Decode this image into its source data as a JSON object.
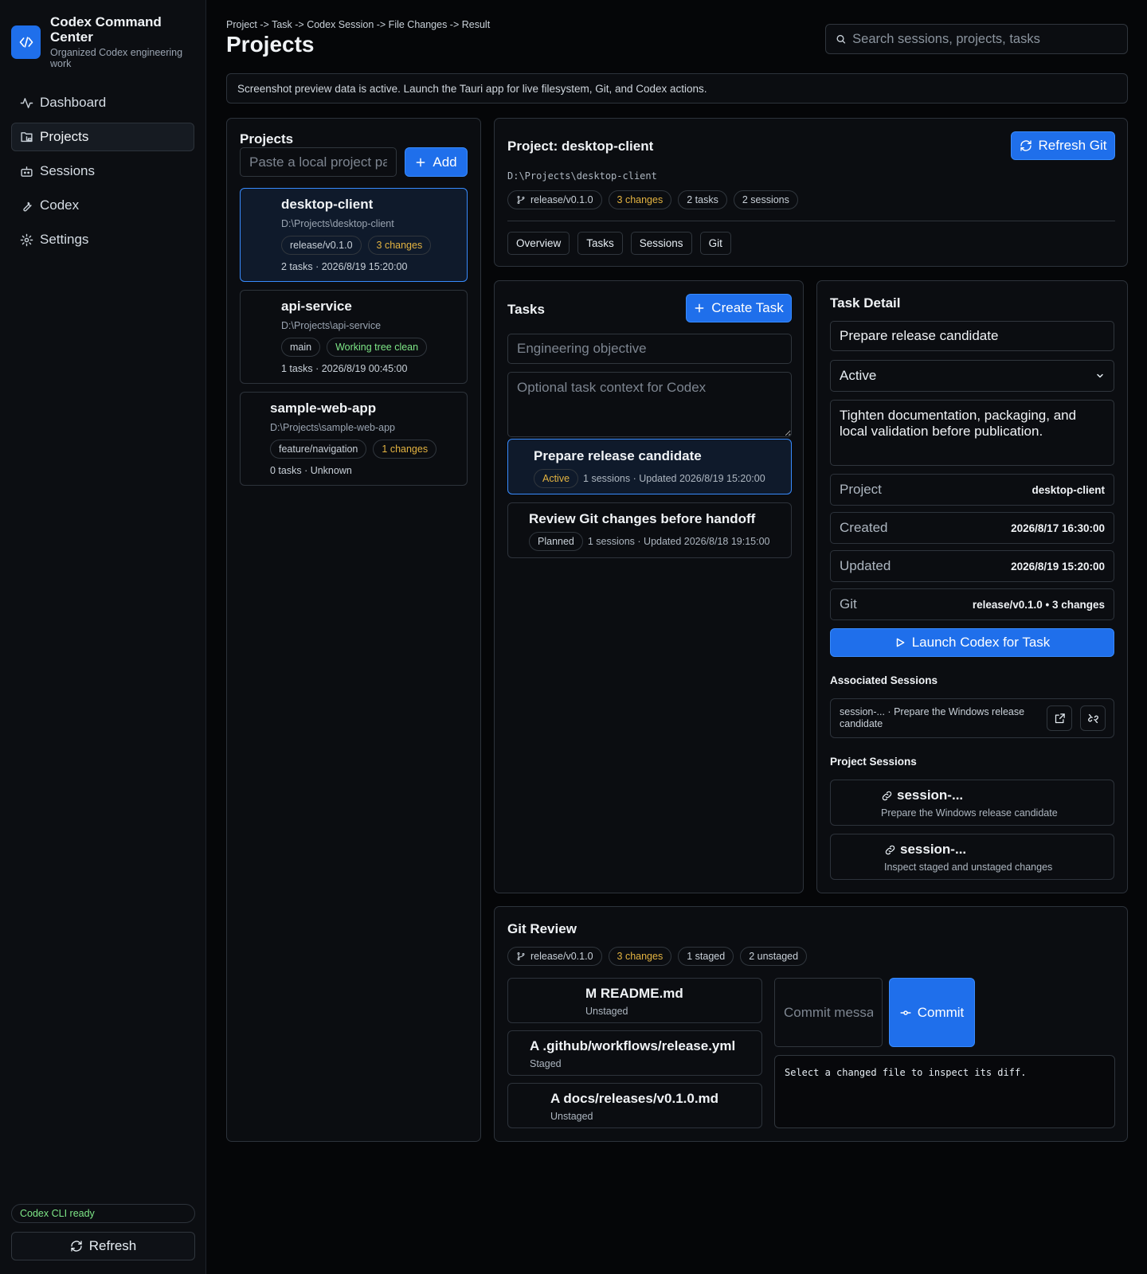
{
  "app": {
    "title": "Codex Command Center",
    "subtitle": "Organized Codex engineering work"
  },
  "nav": {
    "dashboard": "Dashboard",
    "projects": "Projects",
    "sessions": "Sessions",
    "codex": "Codex",
    "settings": "Settings"
  },
  "sidebar_footer": {
    "status": "Codex CLI ready",
    "refresh": "Refresh"
  },
  "header": {
    "breadcrumb": "Project -> Task -> Codex Session -> File Changes -> Result",
    "title": "Projects",
    "search_placeholder": "Search sessions, projects, tasks"
  },
  "notice": "Screenshot preview data is active. Launch the Tauri app for live filesystem, Git, and Codex actions.",
  "projects_panel": {
    "title": "Projects",
    "path_placeholder": "Paste a local project path",
    "add_label": "Add",
    "items": [
      {
        "name": "desktop-client",
        "path": "D:\\Projects\\desktop-client",
        "branch": "release/v0.1.0",
        "status": "3 changes",
        "meta": "2 tasks · 2026/8/19 15:20:00"
      },
      {
        "name": "api-service",
        "path": "D:\\Projects\\api-service",
        "branch": "main",
        "status": "Working tree clean",
        "meta": "1 tasks · 2026/8/19 00:45:00"
      },
      {
        "name": "sample-web-app",
        "path": "D:\\Projects\\sample-web-app",
        "branch": "feature/navigation",
        "status": "1 changes",
        "meta": "0 tasks · Unknown"
      }
    ]
  },
  "project_header": {
    "title": "Project: desktop-client",
    "path": "D:\\Projects\\desktop-client",
    "refresh_label": "Refresh Git",
    "pills": {
      "branch": "release/v0.1.0",
      "changes": "3 changes",
      "tasks": "2 tasks",
      "sessions": "2 sessions"
    },
    "tabs": [
      "Overview",
      "Tasks",
      "Sessions",
      "Git"
    ]
  },
  "tasks_panel": {
    "title": "Tasks",
    "create_label": "Create Task",
    "objective_placeholder": "Engineering objective",
    "context_placeholder": "Optional task context for Codex",
    "items": [
      {
        "title": "Prepare release candidate",
        "status": "Active",
        "meta": "1 sessions · Updated 2026/8/19 15:20:00"
      },
      {
        "title": "Review Git changes before handoff",
        "status": "Planned",
        "meta": "1 sessions · Updated 2026/8/18 19:15:00"
      }
    ]
  },
  "task_detail": {
    "title": "Task Detail",
    "name_value": "Prepare release candidate",
    "status_value": "Active",
    "description": "Tighten documentation, packaging, and local validation before publication.",
    "rows": [
      {
        "key": "Project",
        "value": "desktop-client"
      },
      {
        "key": "Created",
        "value": "2026/8/17 16:30:00"
      },
      {
        "key": "Updated",
        "value": "2026/8/19 15:20:00"
      },
      {
        "key": "Git",
        "value": "release/v0.1.0 • 3 changes"
      }
    ],
    "launch_label": "Launch Codex for Task",
    "associated_title": "Associated Sessions",
    "associated": {
      "text": "session-... · Prepare the Windows release candidate"
    },
    "project_sessions_title": "Project Sessions",
    "project_sessions": [
      {
        "id": "session-...",
        "desc": "Prepare the Windows release candidate"
      },
      {
        "id": "session-...",
        "desc": "Inspect staged and unstaged changes"
      }
    ]
  },
  "git_review": {
    "title": "Git Review",
    "pills": {
      "branch": "release/v0.1.0",
      "changes": "3 changes",
      "staged": "1 staged",
      "unstaged": "2 unstaged"
    },
    "files": [
      {
        "name": "M README.md",
        "state": "Unstaged"
      },
      {
        "name": "A .github/workflows/release.yml",
        "state": "Staged"
      },
      {
        "name": "A docs/releases/v0.1.0.md",
        "state": "Unstaged"
      }
    ],
    "commit_placeholder": "Commit message",
    "commit_label": "Commit",
    "diff_text": "Select a changed file to inspect its diff."
  },
  "colors": {
    "accent": "#1f6feb",
    "warn": "#e3b341",
    "ok": "#7ee787",
    "bg": "#050608"
  }
}
